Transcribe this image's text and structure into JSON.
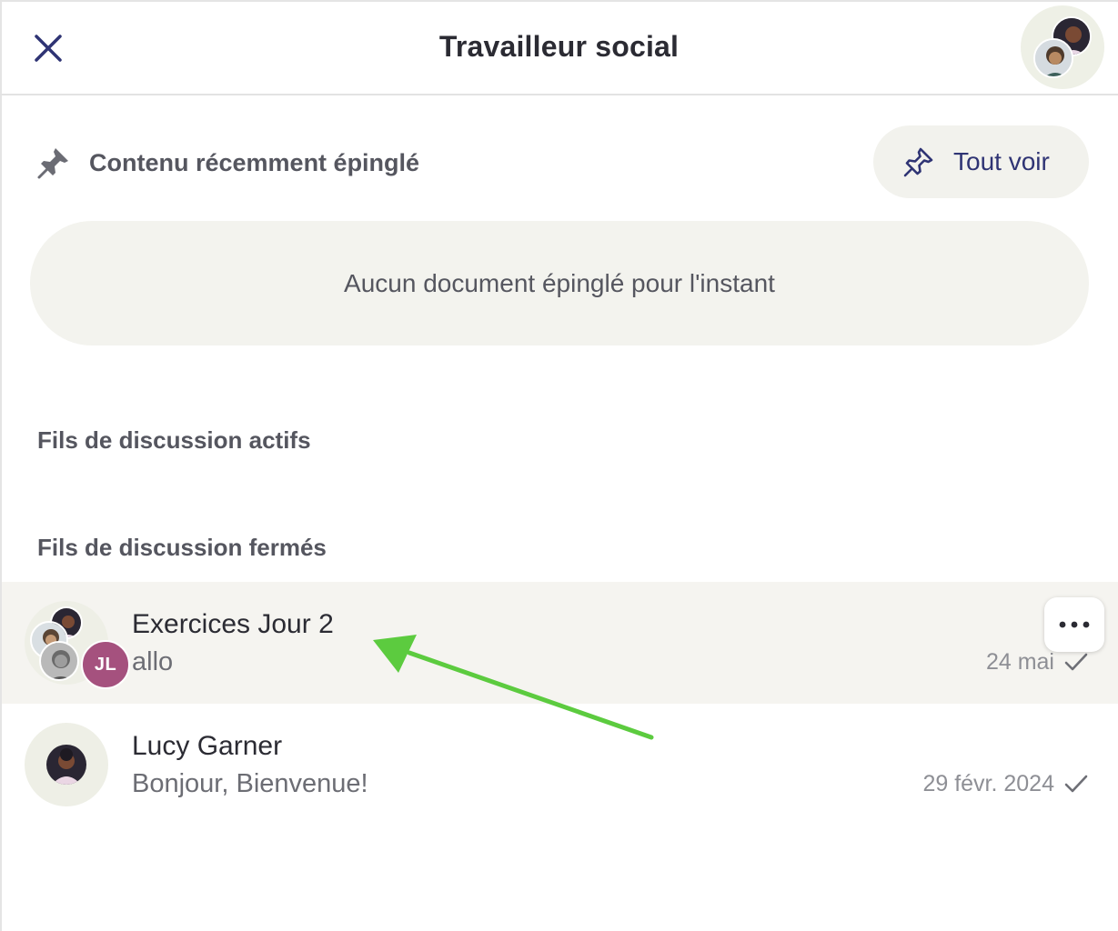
{
  "header": {
    "title": "Travailleur social",
    "close_icon": "close-icon"
  },
  "pinned": {
    "label": "Contenu récemment épinglé",
    "see_all_label": "Tout voir",
    "empty_message": "Aucun document épinglé pour l'instant"
  },
  "sections": {
    "active_title": "Fils de discussion actifs",
    "closed_title": "Fils de discussion fermés"
  },
  "threads": [
    {
      "name": "Exercices Jour 2",
      "preview": "allo",
      "date": "24 mai",
      "avatar_initials": "JL",
      "highlighted": true
    },
    {
      "name": "Lucy Garner",
      "preview": "Bonjour, Bienvenue!",
      "date": "29 févr. 2024",
      "highlighted": false
    }
  ],
  "colors": {
    "accent": "#2f3474",
    "initials_avatar": "#a5517e",
    "highlight_row": "#f5f4f0",
    "annotation_arrow": "#5ccb3f"
  }
}
